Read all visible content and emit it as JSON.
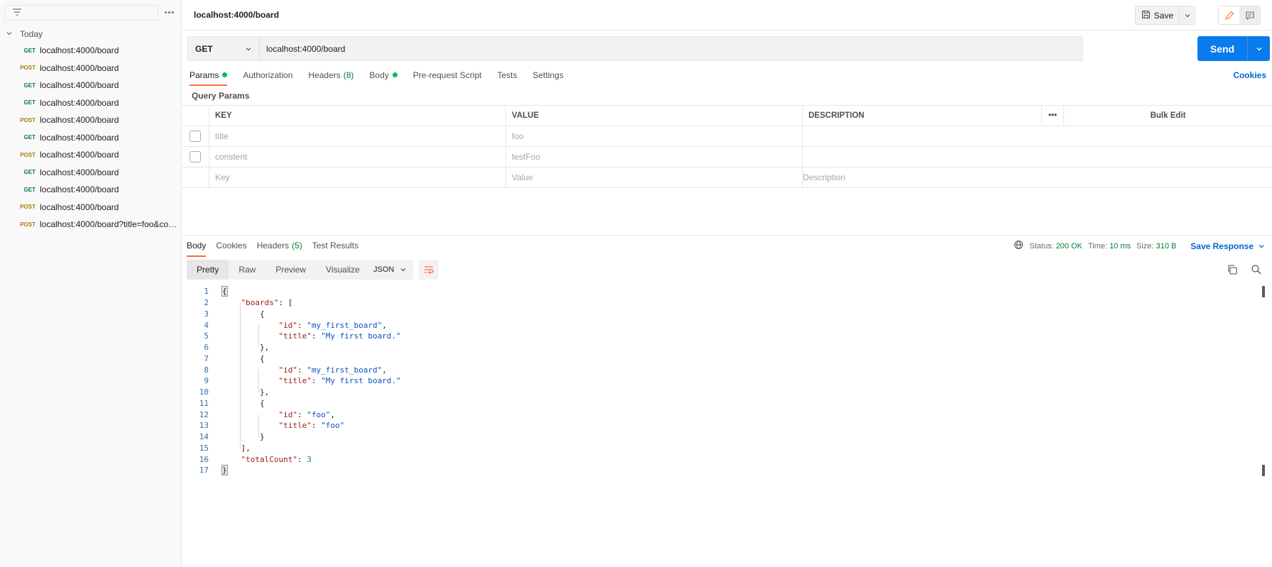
{
  "sidebar": {
    "filter_icon": "filter-icon",
    "more_label": "•••",
    "group_label": "Today",
    "history": [
      {
        "method": "GET",
        "url": "localhost:4000/board"
      },
      {
        "method": "POST",
        "url": "localhost:4000/board"
      },
      {
        "method": "GET",
        "url": "localhost:4000/board"
      },
      {
        "method": "GET",
        "url": "localhost:4000/board"
      },
      {
        "method": "POST",
        "url": "localhost:4000/board"
      },
      {
        "method": "GET",
        "url": "localhost:4000/board"
      },
      {
        "method": "POST",
        "url": "localhost:4000/board"
      },
      {
        "method": "GET",
        "url": "localhost:4000/board"
      },
      {
        "method": "GET",
        "url": "localhost:4000/board"
      },
      {
        "method": "POST",
        "url": "localhost:4000/board"
      },
      {
        "method": "POST",
        "url": "localhost:4000/board?title=foo&con..."
      }
    ]
  },
  "header": {
    "title": "localhost:4000/board",
    "save_label": "Save"
  },
  "request": {
    "method": "GET",
    "url": "localhost:4000/board",
    "send_label": "Send",
    "tabs": [
      {
        "label": "Params",
        "dot": true,
        "active": true
      },
      {
        "label": "Authorization"
      },
      {
        "label": "Headers",
        "count": "(8)"
      },
      {
        "label": "Body",
        "dot": true
      },
      {
        "label": "Pre-request Script"
      },
      {
        "label": "Tests"
      },
      {
        "label": "Settings"
      }
    ],
    "cookies_label": "Cookies",
    "query_params_label": "Query Params",
    "table": {
      "headers": {
        "key": "KEY",
        "value": "VALUE",
        "description": "DESCRIPTION",
        "more": "•••",
        "bulk": "Bulk Edit"
      },
      "rows": [
        {
          "key": "title",
          "value": "foo",
          "description": ""
        },
        {
          "key": "constent",
          "value": "testFoo",
          "description": ""
        }
      ],
      "placeholder": {
        "key": "Key",
        "value": "Value",
        "description": "Description"
      }
    }
  },
  "response": {
    "tabs": [
      {
        "label": "Body",
        "active": true
      },
      {
        "label": "Cookies"
      },
      {
        "label": "Headers",
        "count": "(5)"
      },
      {
        "label": "Test Results"
      }
    ],
    "status_label": "Status:",
    "status_value": "200 OK",
    "time_label": "Time:",
    "time_value": "10 ms",
    "size_label": "Size:",
    "size_value": "310 B",
    "save_response_label": "Save Response",
    "views": [
      "Pretty",
      "Raw",
      "Preview",
      "Visualize"
    ],
    "active_view": "Pretty",
    "format": "JSON",
    "code_lines": [
      [
        [
          "p",
          "{"
        ]
      ],
      [
        [
          "p",
          "    "
        ],
        [
          "k",
          "\"boards\""
        ],
        [
          "p",
          ": ["
        ]
      ],
      [
        [
          "p",
          "        {"
        ]
      ],
      [
        [
          "p",
          "            "
        ],
        [
          "k",
          "\"id\""
        ],
        [
          "p",
          ": "
        ],
        [
          "s",
          "\"my_first_board\""
        ],
        [
          "p",
          ","
        ]
      ],
      [
        [
          "p",
          "            "
        ],
        [
          "k",
          "\"title\""
        ],
        [
          "p",
          ": "
        ],
        [
          "s",
          "\"My first board.\""
        ]
      ],
      [
        [
          "p",
          "        },"
        ]
      ],
      [
        [
          "p",
          "        {"
        ]
      ],
      [
        [
          "p",
          "            "
        ],
        [
          "k",
          "\"id\""
        ],
        [
          "p",
          ": "
        ],
        [
          "s",
          "\"my_first_board\""
        ],
        [
          "p",
          ","
        ]
      ],
      [
        [
          "p",
          "            "
        ],
        [
          "k",
          "\"title\""
        ],
        [
          "p",
          ": "
        ],
        [
          "s",
          "\"My first board.\""
        ]
      ],
      [
        [
          "p",
          "        },"
        ]
      ],
      [
        [
          "p",
          "        {"
        ]
      ],
      [
        [
          "p",
          "            "
        ],
        [
          "k",
          "\"id\""
        ],
        [
          "p",
          ": "
        ],
        [
          "s",
          "\"foo\""
        ],
        [
          "p",
          ","
        ]
      ],
      [
        [
          "p",
          "            "
        ],
        [
          "k",
          "\"title\""
        ],
        [
          "p",
          ": "
        ],
        [
          "s",
          "\"foo\""
        ]
      ],
      [
        [
          "p",
          "        }"
        ]
      ],
      [
        [
          "p",
          "    ],"
        ]
      ],
      [
        [
          "p",
          "    "
        ],
        [
          "k",
          "\"totalCount\""
        ],
        [
          "p",
          ": "
        ],
        [
          "n",
          "3"
        ]
      ],
      [
        [
          "p",
          "}"
        ]
      ]
    ]
  },
  "colors": {
    "accent": "#ff6c37",
    "primary": "#097bed",
    "get": "#007f31",
    "post": "#ad7a03",
    "status_ok": "#007f31"
  }
}
